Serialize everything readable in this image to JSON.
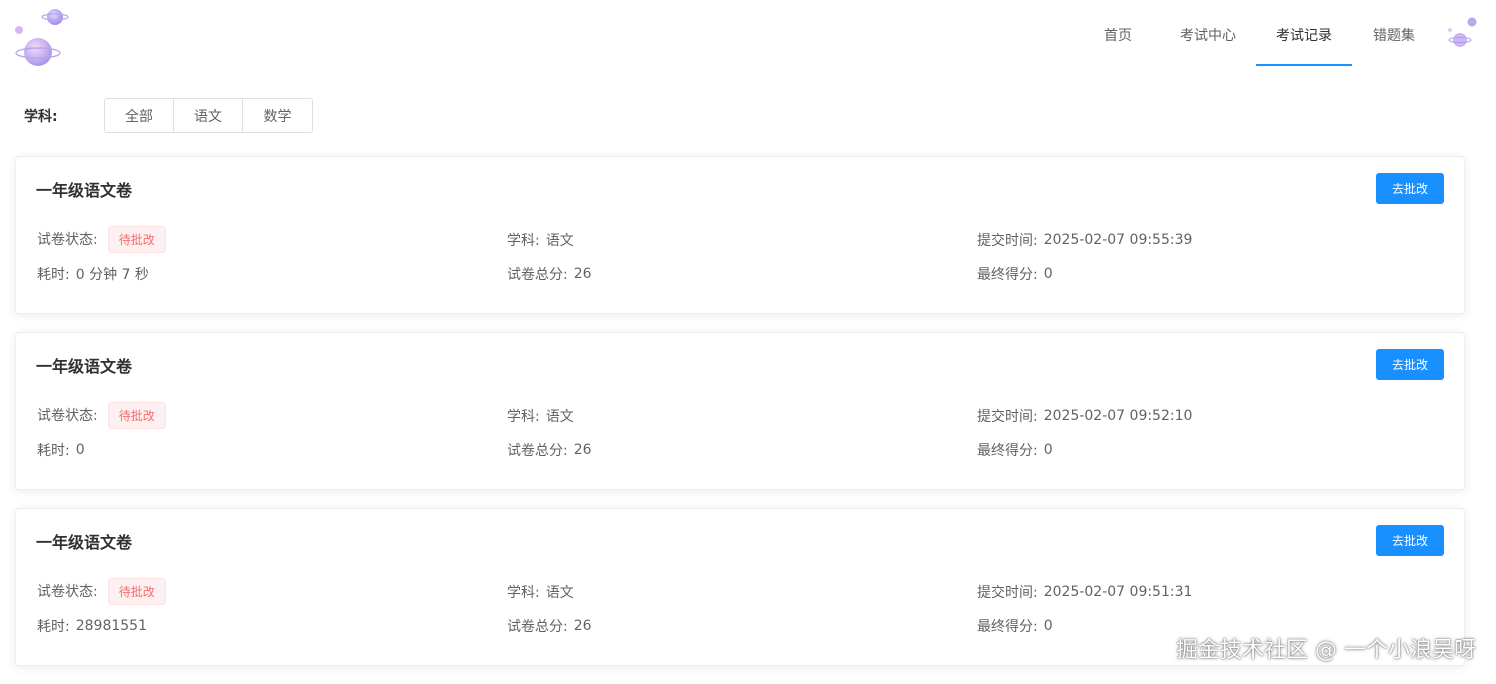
{
  "nav": {
    "items": [
      {
        "label": "首页",
        "active": false
      },
      {
        "label": "考试中心",
        "active": false
      },
      {
        "label": "考试记录",
        "active": true
      },
      {
        "label": "错题集",
        "active": false
      }
    ]
  },
  "filter": {
    "label": "学科:",
    "options": [
      "全部",
      "语文",
      "数学"
    ]
  },
  "records": [
    {
      "title": "一年级语文卷",
      "action": "去批改",
      "status_label": "试卷状态:",
      "status": "待批改",
      "subject_label": "学科:",
      "subject": "语文",
      "submit_label": "提交时间:",
      "submit_time": "2025-02-07 09:55:39",
      "duration_label": "耗时:",
      "duration": "0 分钟 7 秒",
      "total_label": "试卷总分:",
      "total": "26",
      "score_label": "最终得分:",
      "score": "0"
    },
    {
      "title": "一年级语文卷",
      "action": "去批改",
      "status_label": "试卷状态:",
      "status": "待批改",
      "subject_label": "学科:",
      "subject": "语文",
      "submit_label": "提交时间:",
      "submit_time": "2025-02-07 09:52:10",
      "duration_label": "耗时:",
      "duration": "0",
      "total_label": "试卷总分:",
      "total": "26",
      "score_label": "最终得分:",
      "score": "0"
    },
    {
      "title": "一年级语文卷",
      "action": "去批改",
      "status_label": "试卷状态:",
      "status": "待批改",
      "subject_label": "学科:",
      "subject": "语文",
      "submit_label": "提交时间:",
      "submit_time": "2025-02-07 09:51:31",
      "duration_label": "耗时:",
      "duration": "28981551",
      "total_label": "试卷总分:",
      "total": "26",
      "score_label": "最终得分:",
      "score": "0"
    }
  ],
  "colors": {
    "accent": "#1890ff",
    "tag_text": "#f56c6c",
    "tag_bg": "#fef0f0"
  },
  "watermark": "掘金技术社区 @ 一个小浪吴呀"
}
